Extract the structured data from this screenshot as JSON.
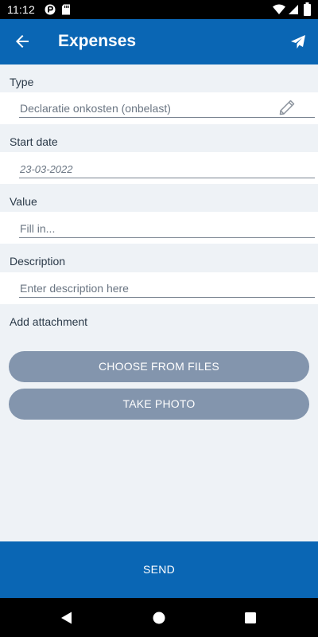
{
  "status_bar": {
    "time": "11:12",
    "icons": [
      "vpn-key-icon",
      "sd-card-icon",
      "wifi-icon",
      "signal-icon",
      "battery-icon"
    ]
  },
  "app_bar": {
    "title": "Expenses",
    "back_icon": "arrow-back-icon",
    "action_icon": "paper-plane-icon",
    "background": "#0a66b4"
  },
  "form": {
    "type": {
      "label": "Type",
      "value": "Declaratie onkosten (onbelast)",
      "icon": "pencil-icon"
    },
    "start_date": {
      "label": "Start date",
      "value": "23-03-2022"
    },
    "value": {
      "label": "Value",
      "placeholder": "Fill in..."
    },
    "description": {
      "label": "Description",
      "placeholder": "Enter description here"
    },
    "attachment": {
      "label": "Add attachment",
      "choose_files_label": "CHOOSE FROM FILES",
      "take_photo_label": "TAKE PHOTO"
    }
  },
  "footer": {
    "send_label": "SEND"
  },
  "nav_bar": {
    "icons": [
      "back-triangle-icon",
      "home-circle-icon",
      "recents-square-icon"
    ]
  },
  "colors": {
    "primary": "#0a66b4",
    "button": "#8395ad",
    "background": "#eef2f6"
  }
}
